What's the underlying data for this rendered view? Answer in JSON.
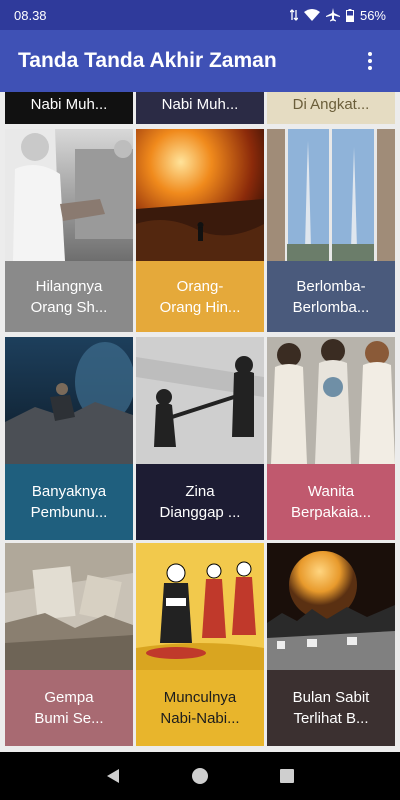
{
  "status": {
    "time": "08.38",
    "battery": "56%"
  },
  "app": {
    "title": "Tanda Tanda Akhir Zaman",
    "menu_icon": "more-vert-icon"
  },
  "colors": {
    "statusbar": "#2f3a9b",
    "appbar": "#3f51b5",
    "cap_gray": "#8a8a8a",
    "cap_orange": "#e5a93a",
    "cap_slate": "#4a5a7c",
    "cap_teal": "#1f5f7e",
    "cap_navy": "#1d1c33",
    "cap_rose": "#c0596e",
    "cap_mauve": "#a86a72",
    "cap_yellow": "#e8b52c",
    "cap_dark": "#3b3030"
  },
  "partial_row": [
    {
      "label": "Nabi Muh..."
    },
    {
      "label": "Nabi Muh..."
    },
    {
      "label": "Di Angkat..."
    }
  ],
  "cards": [
    {
      "label": "Hilangnya\nOrang Sh..."
    },
    {
      "label": "Orang-\nOrang Hin..."
    },
    {
      "label": "Berlomba-\nBerlomba..."
    },
    {
      "label": "Banyaknya\nPembunu..."
    },
    {
      "label": "Zina\nDianggap ..."
    },
    {
      "label": "Wanita\nBerpakaia..."
    },
    {
      "label": "Gempa\nBumi Se..."
    },
    {
      "label": "Munculnya\nNabi-Nabi..."
    },
    {
      "label": "Bulan Sabit\nTerlihat B..."
    }
  ],
  "nav": {
    "back": "back-icon",
    "home": "home-icon",
    "recents": "recents-icon"
  }
}
